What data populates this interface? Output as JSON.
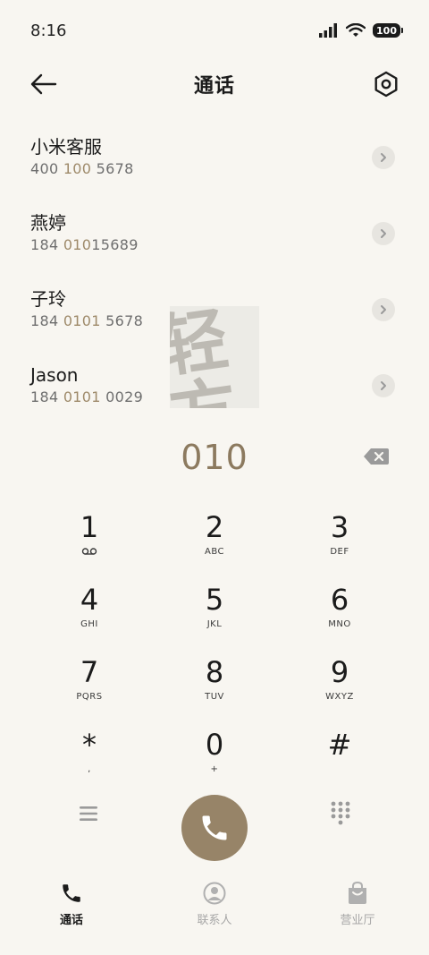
{
  "status": {
    "time": "8:16",
    "battery": "100"
  },
  "header": {
    "title": "通话",
    "back_icon": "back-arrow-icon",
    "settings_icon": "settings-hexagon-icon"
  },
  "watermark": {
    "text": "轻方"
  },
  "contacts": [
    {
      "name": "小米客服",
      "num_a": "400 ",
      "num_hl": "100",
      "num_b": " 5678"
    },
    {
      "name": "燕婷",
      "num_a": "184 ",
      "num_hl": "010",
      "num_b": "15689"
    },
    {
      "name": "子玲",
      "num_a": "184 ",
      "num_hl": "0101",
      "num_b": " 5678"
    },
    {
      "name": "Jason",
      "num_a": "184 ",
      "num_hl": "0101",
      "num_b": " 0029"
    }
  ],
  "dial": {
    "number": "010"
  },
  "keypad": [
    {
      "digit": "1",
      "sub": ""
    },
    {
      "digit": "2",
      "sub": "ABC"
    },
    {
      "digit": "3",
      "sub": "DEF"
    },
    {
      "digit": "4",
      "sub": "GHI"
    },
    {
      "digit": "5",
      "sub": "JKL"
    },
    {
      "digit": "6",
      "sub": "MNO"
    },
    {
      "digit": "7",
      "sub": "PQRS"
    },
    {
      "digit": "8",
      "sub": "TUV"
    },
    {
      "digit": "9",
      "sub": "WXYZ"
    },
    {
      "digit": "*",
      "sub": ","
    },
    {
      "digit": "0",
      "sub": "+"
    },
    {
      "digit": "#",
      "sub": ""
    }
  ],
  "nav": [
    {
      "label": "通话",
      "icon": "phone-icon",
      "active": true
    },
    {
      "label": "联系人",
      "icon": "person-icon",
      "active": false
    },
    {
      "label": "营业厅",
      "icon": "shopping-bag-icon",
      "active": false
    }
  ],
  "colors": {
    "accent": "#978468",
    "highlight": "#9e8a6a",
    "background": "#f8f6f1"
  }
}
